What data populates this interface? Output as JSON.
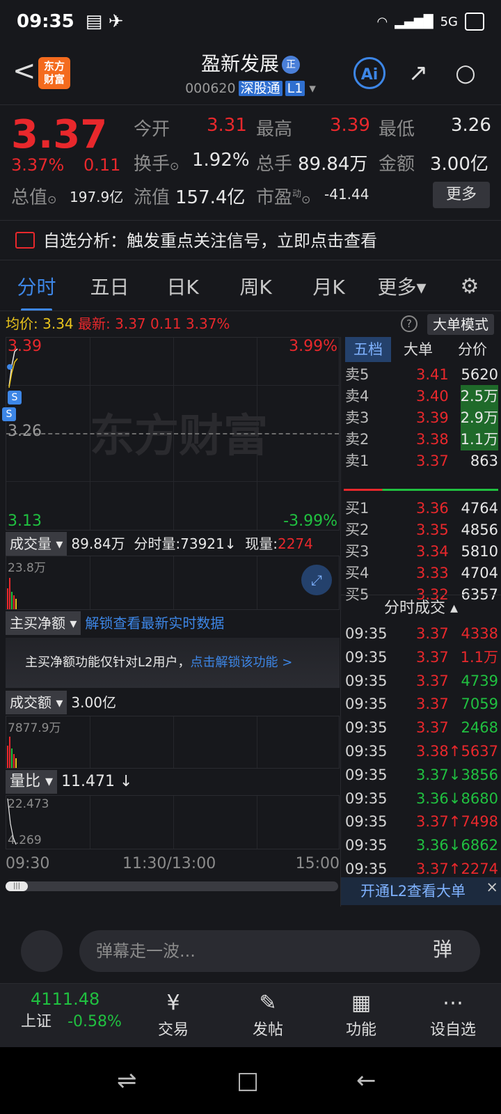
{
  "status": {
    "time": "09:35",
    "network": "5G"
  },
  "header": {
    "back": "<",
    "logo": "东方\n财富",
    "stock_name": "盈新发展",
    "zheng_badge": "正",
    "code": "000620",
    "market_tag": "深股通",
    "level_tag": "L1",
    "ai_label": "Ai"
  },
  "quote": {
    "price": "3.37",
    "change_pct": "3.37%",
    "change": "0.11",
    "labels": {
      "open": "今开",
      "high": "最高",
      "low": "最低",
      "turnover": "换手",
      "volume": "总手",
      "amount": "金额",
      "mktcap": "总值",
      "float": "流值",
      "pe": "市盈",
      "pe_sup": "动",
      "more": "更多"
    },
    "values": {
      "open": "3.31",
      "high": "3.39",
      "low": "3.26",
      "turnover": "1.92%",
      "volume": "89.84万",
      "amount": "3.00亿",
      "mktcap": "197.9亿",
      "float": "157.4亿",
      "pe": "-41.44"
    }
  },
  "signal": {
    "text": "自选分析：触发重点关注信号，立即点击查看"
  },
  "tabs": [
    "分时",
    "五日",
    "日K",
    "周K",
    "月K",
    "更多▾"
  ],
  "avgline": {
    "avg_label": "均价:",
    "avg": "3.34",
    "latest_label": "最新:",
    "latest": "3.37",
    "chg": "0.11",
    "pct": "3.37%",
    "big_mode": "大单模式"
  },
  "chart": {
    "top_price": "3.39",
    "top_pct": "3.99%",
    "mid_price": "3.26",
    "bottom_price": "3.13",
    "bottom_pct": "-3.99%",
    "watermark": "东方财富",
    "vol_label": "成交量",
    "vol_total": "89.84万",
    "vol_minute": "分时量:73921↓",
    "vol_now_label": "现量:",
    "vol_now": "2274",
    "vol_max": "23.8万",
    "net_label": "主买净额",
    "net_unlock": "解锁查看最新实时数据",
    "lock_text": "主买净额功能仅针对L2用户，",
    "lock_link": "点击解锁该功能 >",
    "amt_label": "成交额",
    "amt_total": "3.00亿",
    "amt_max": "7877.9万",
    "ratio_label": "量比",
    "ratio_val": "11.471 ↓",
    "ratio_max": "22.473",
    "ratio_min": "4.269",
    "x_start": "09:30",
    "x_mid": "11:30/13:00",
    "x_end": "15:00"
  },
  "book": {
    "tabs": [
      "五档",
      "大单",
      "分价"
    ],
    "asks": [
      {
        "l": "卖5",
        "p": "3.41",
        "v": "5620"
      },
      {
        "l": "卖4",
        "p": "3.40",
        "v": "2.5万"
      },
      {
        "l": "卖3",
        "p": "3.39",
        "v": "2.9万"
      },
      {
        "l": "卖2",
        "p": "3.38",
        "v": "1.1万"
      },
      {
        "l": "卖1",
        "p": "3.37",
        "v": "863"
      }
    ],
    "bids": [
      {
        "l": "买1",
        "p": "3.36",
        "v": "4764"
      },
      {
        "l": "买2",
        "p": "3.35",
        "v": "4856"
      },
      {
        "l": "买3",
        "p": "3.34",
        "v": "5810"
      },
      {
        "l": "买4",
        "p": "3.33",
        "v": "4704"
      },
      {
        "l": "买5",
        "p": "3.32",
        "v": "6357"
      }
    ],
    "ticks_title": "分时成交 ▴",
    "ticks": [
      {
        "t": "09:35",
        "p": "3.37",
        "v": "4338",
        "c": "red"
      },
      {
        "t": "09:35",
        "p": "3.37",
        "v": "1.1万",
        "c": "red"
      },
      {
        "t": "09:35",
        "p": "3.37",
        "v": "4739",
        "c": "green"
      },
      {
        "t": "09:35",
        "p": "3.37",
        "v": "7059",
        "c": "green"
      },
      {
        "t": "09:35",
        "p": "3.37",
        "v": "2468",
        "c": "green"
      },
      {
        "t": "09:35",
        "p": "3.38↑",
        "v": "5637",
        "c": "red"
      },
      {
        "t": "09:35",
        "p": "3.37↓",
        "v": "3856",
        "c": "green"
      },
      {
        "t": "09:35",
        "p": "3.36↓",
        "v": "8680",
        "c": "green"
      },
      {
        "t": "09:35",
        "p": "3.37↑",
        "v": "7498",
        "c": "red"
      },
      {
        "t": "09:35",
        "p": "3.36↓",
        "v": "6862",
        "c": "green"
      },
      {
        "t": "09:35",
        "p": "3.37↑",
        "v": "2274",
        "c": "red"
      }
    ],
    "l2_text": "开通L2查看大单"
  },
  "comment": {
    "placeholder": "弹幕走一波...",
    "danmu": "弹"
  },
  "bottom": {
    "index_value": "4111.48",
    "index_name": "上证",
    "index_pct": "-0.58%",
    "trade": "交易",
    "post": "发帖",
    "func": "功能",
    "fav": "设自选"
  }
}
